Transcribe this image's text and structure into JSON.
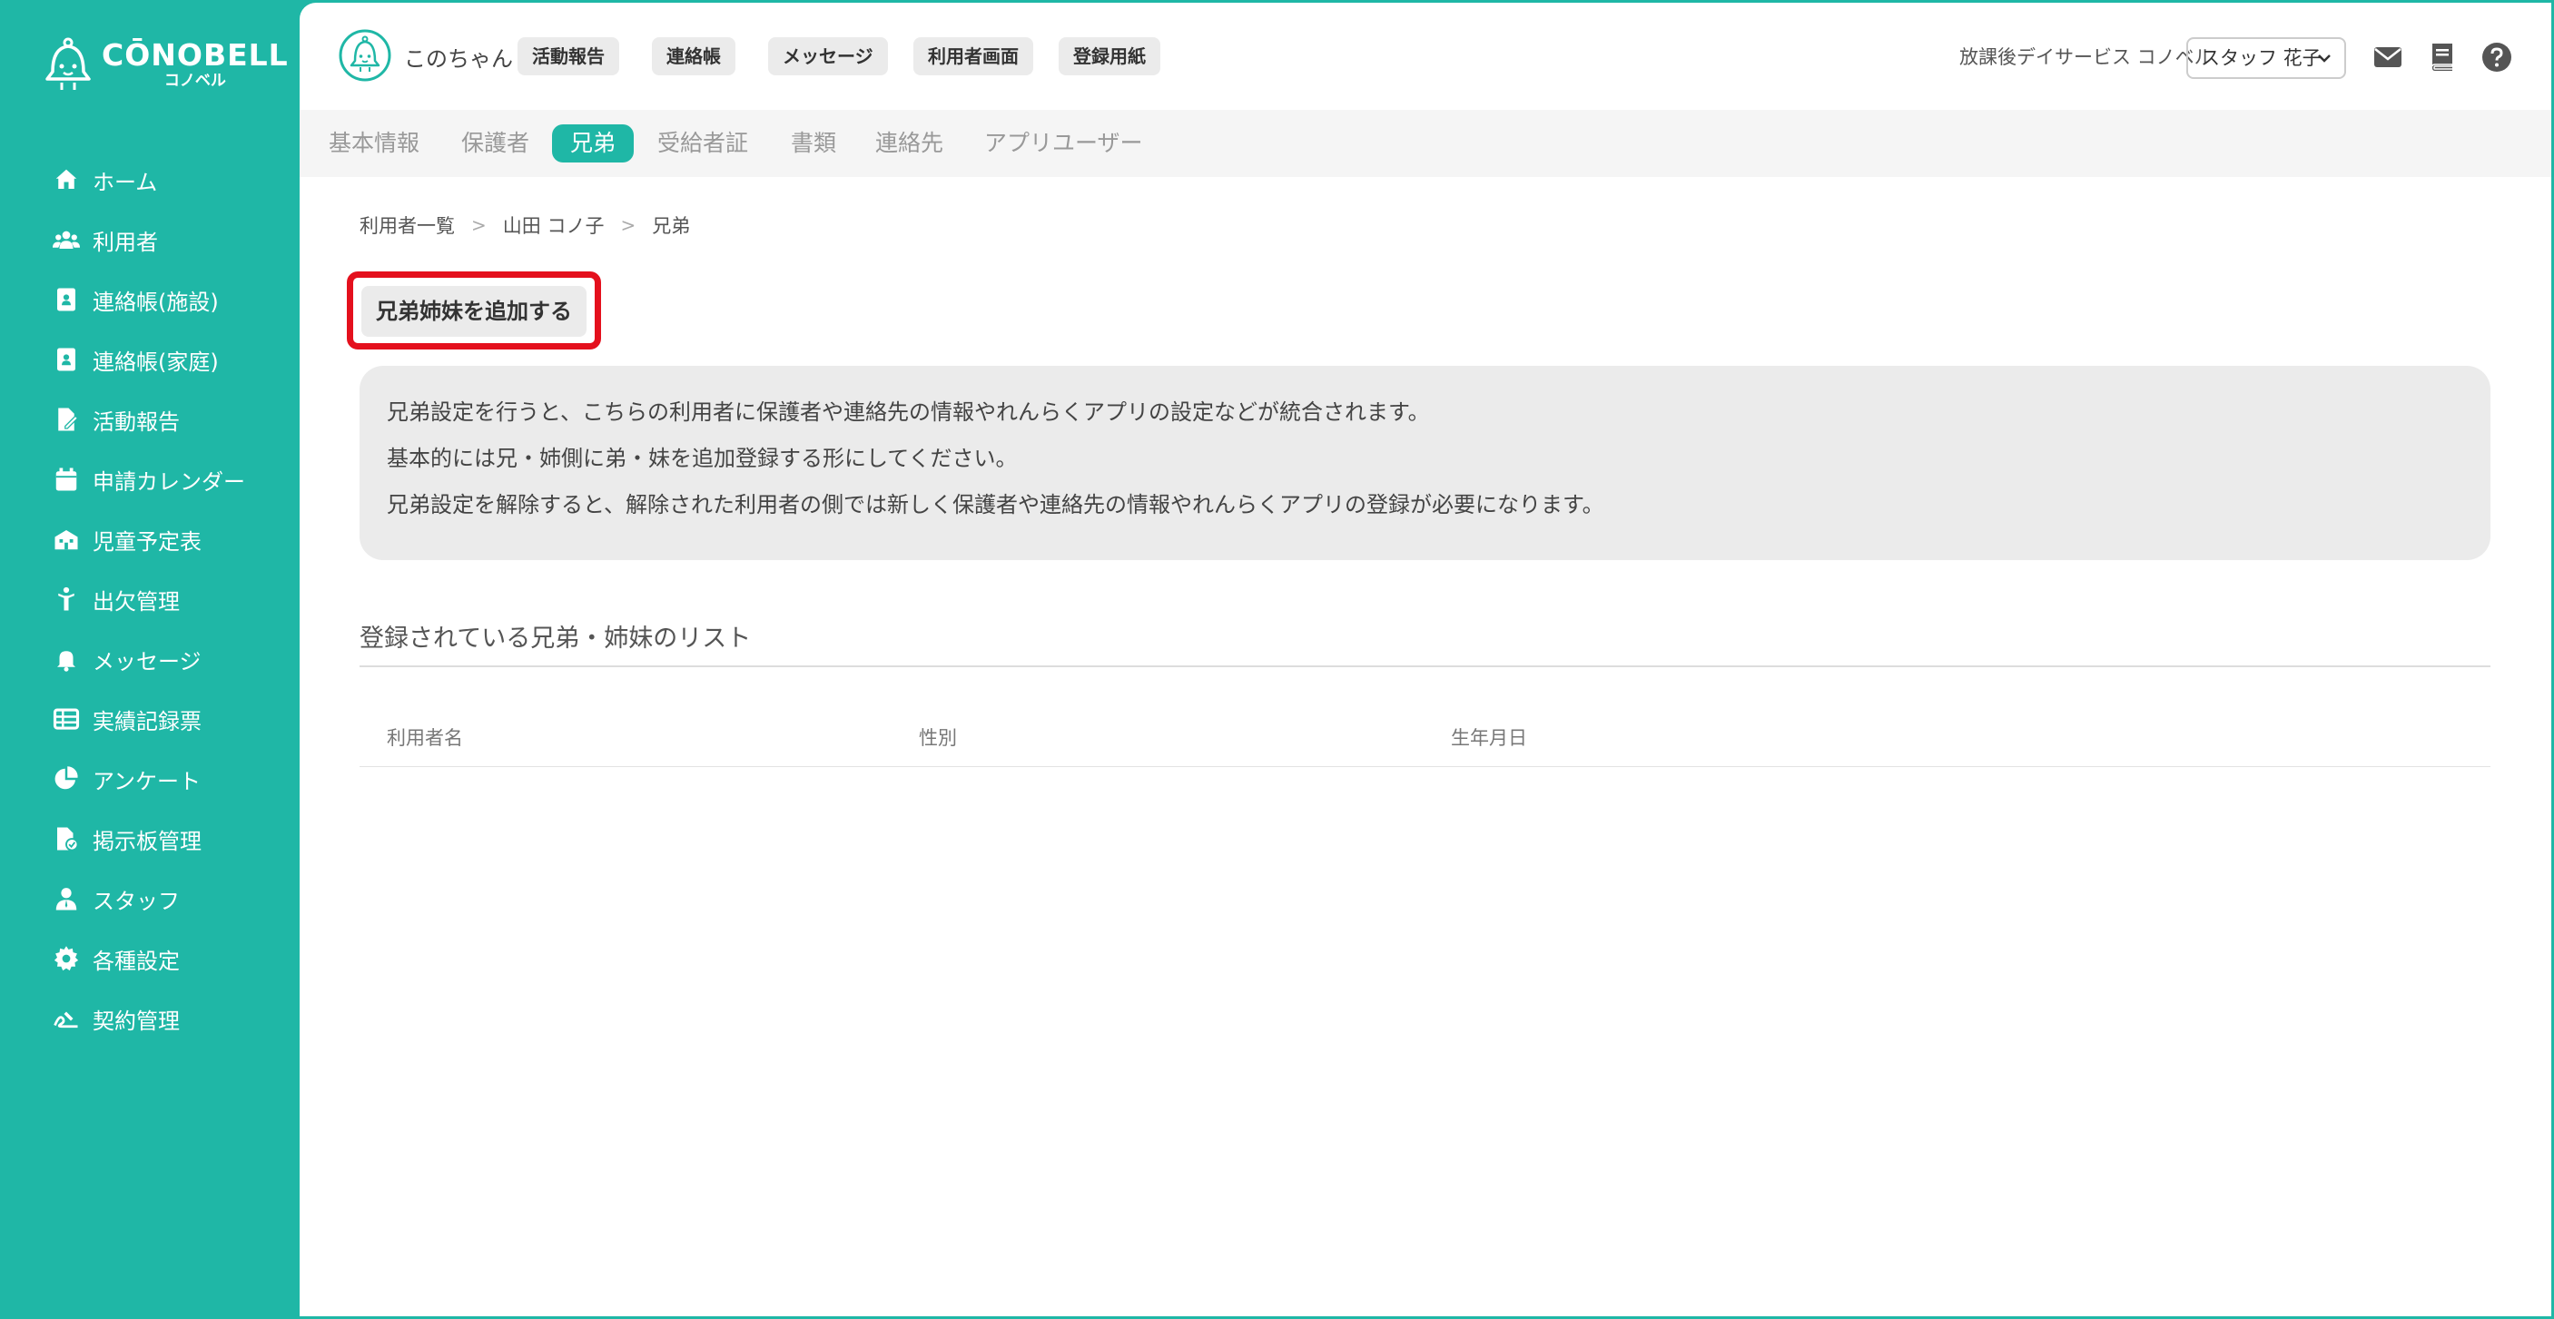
{
  "logo": {
    "main": "CŌNOBELL",
    "sub": "コノベル"
  },
  "sidebar": {
    "items": [
      {
        "label": "ホーム",
        "icon": "home-icon"
      },
      {
        "label": "利用者",
        "icon": "users-icon"
      },
      {
        "label": "連絡帳(施設)",
        "icon": "contact-book-icon"
      },
      {
        "label": "連絡帳(家庭)",
        "icon": "contact-book-icon"
      },
      {
        "label": "活動報告",
        "icon": "report-icon"
      },
      {
        "label": "申請カレンダー",
        "icon": "calendar-icon"
      },
      {
        "label": "児童予定表",
        "icon": "schedule-icon"
      },
      {
        "label": "出欠管理",
        "icon": "attendance-icon"
      },
      {
        "label": "メッセージ",
        "icon": "bell-icon"
      },
      {
        "label": "実績記録票",
        "icon": "table-icon"
      },
      {
        "label": "アンケート",
        "icon": "pie-chart-icon"
      },
      {
        "label": "掲示板管理",
        "icon": "board-icon"
      },
      {
        "label": "スタッフ",
        "icon": "staff-icon"
      },
      {
        "label": "各種設定",
        "icon": "gear-icon"
      },
      {
        "label": "契約管理",
        "icon": "contract-icon"
      }
    ]
  },
  "header": {
    "user_name": "このちゃん",
    "pills": [
      "活動報告",
      "連絡帳",
      "メッセージ",
      "利用者画面",
      "登録用紙"
    ],
    "facility": "放課後デイサービス コノベル",
    "staff_selected": "スタッフ 花子"
  },
  "subtabs": {
    "items": [
      "基本情報",
      "保護者",
      "兄弟",
      "受給者証",
      "書類",
      "連絡先",
      "アプリユーザー"
    ],
    "active": "兄弟"
  },
  "breadcrumb": [
    "利用者一覧",
    "山田 コノ子",
    "兄弟"
  ],
  "add_button_label": "兄弟姉妹を追加する",
  "info_lines": [
    "兄弟設定を行うと、こちらの利用者に保護者や連絡先の情報やれんらくアプリの設定などが統合されます。",
    "基本的には兄・姉側に弟・妹を追加登録する形にしてください。",
    "兄弟設定を解除すると、解除された利用者の側では新しく保護者や連絡先の情報やれんらくアプリの登録が必要になります。"
  ],
  "list": {
    "title": "登録されている兄弟・姉妹のリスト",
    "columns": [
      "利用者名",
      "性別",
      "生年月日"
    ]
  },
  "colors": {
    "accent": "#1fb7a6",
    "highlight": "#e4101d"
  }
}
